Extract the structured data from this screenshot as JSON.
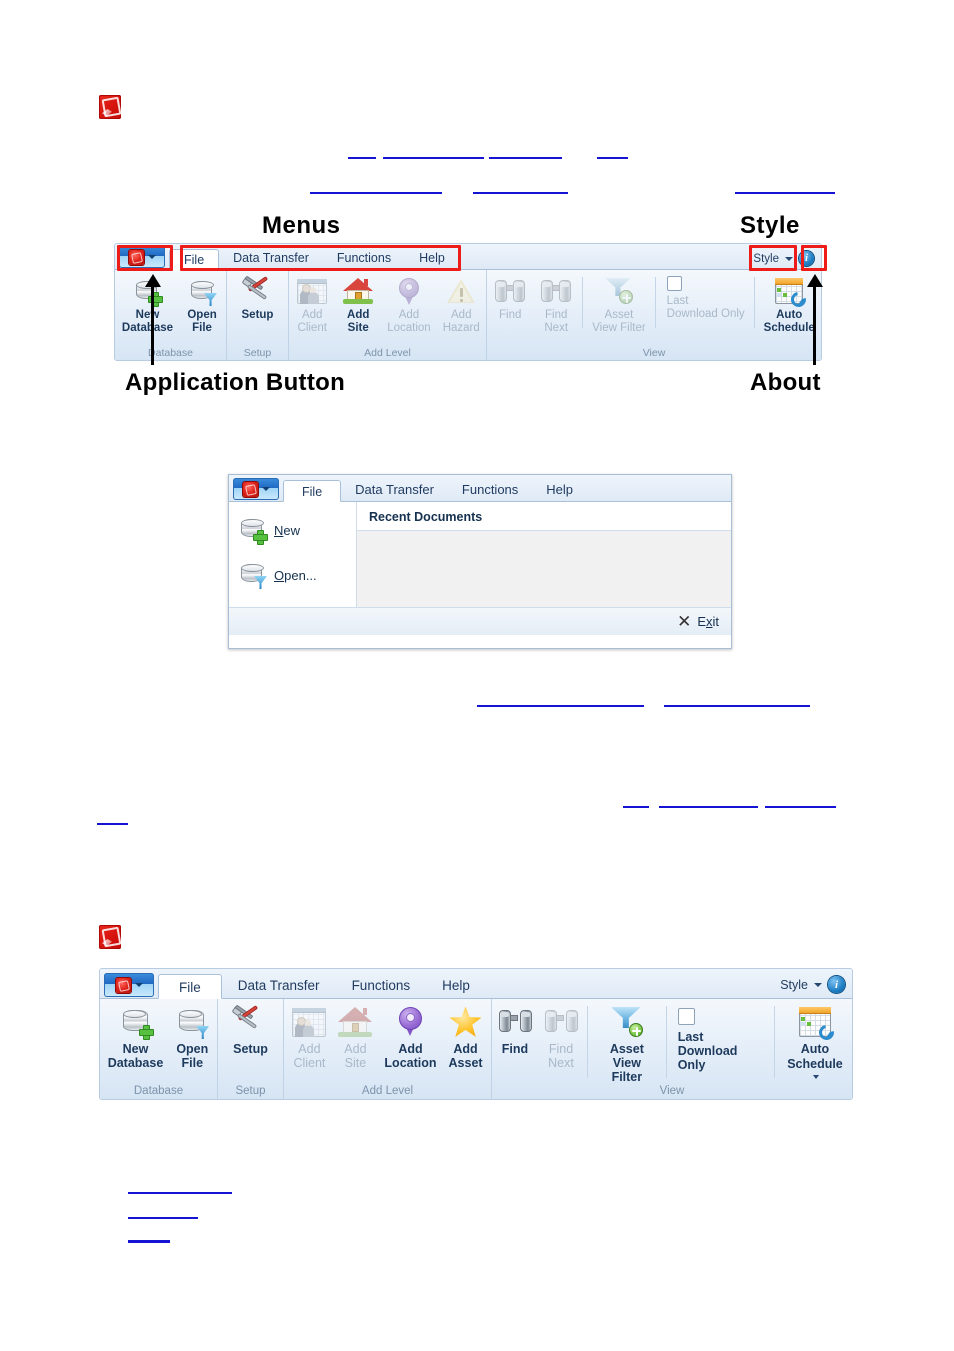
{
  "page": {
    "note_icons": [
      "note-icon-top",
      "note-icon-lower"
    ],
    "link_placeholders_count": 16
  },
  "annotations": {
    "menus_label": "Menus",
    "style_label": "Style",
    "application_button_label": "Application Button",
    "about_label": "About"
  },
  "ribbon_top": {
    "app_button": {
      "name": "Application Button",
      "caret": "▼"
    },
    "tabs": [
      {
        "label": "File",
        "active": true
      },
      {
        "label": "Data Transfer",
        "active": false
      },
      {
        "label": "Functions",
        "active": false
      },
      {
        "label": "Help",
        "active": false
      }
    ],
    "style_button": "Style",
    "about_icon": "i",
    "groups": [
      {
        "title": "Database",
        "buttons": [
          {
            "label": "New\nDatabase",
            "icon": "database-add-icon",
            "disabled": false
          },
          {
            "label": "Open\nFile",
            "icon": "database-open-icon",
            "disabled": false
          }
        ]
      },
      {
        "title": "Setup",
        "buttons": [
          {
            "label": "Setup",
            "icon": "tools-icon",
            "disabled": false
          }
        ]
      },
      {
        "title": "Add Level",
        "buttons": [
          {
            "label": "Add\nClient",
            "icon": "client-card-icon",
            "disabled": true
          },
          {
            "label": "Add\nSite",
            "icon": "house-icon",
            "disabled": false
          },
          {
            "label": "Add\nLocation",
            "icon": "map-pin-icon",
            "disabled": true
          },
          {
            "label": "Add\nHazard",
            "icon": "warning-triangle-icon",
            "disabled": true
          }
        ]
      },
      {
        "title": "View",
        "buttons": [
          {
            "label": "Find",
            "icon": "binoculars-icon",
            "disabled": true
          },
          {
            "label": "Find\nNext",
            "icon": "binoculars-icon",
            "disabled": true
          },
          {
            "label": "Asset\nView Filter",
            "icon": "funnel-add-icon",
            "disabled": true
          },
          {
            "label": "Last\nDownload Only",
            "icon": "checkbox-icon",
            "disabled": true,
            "type": "checkbox"
          },
          {
            "label": "Auto\nSchedule",
            "icon": "calendar-sync-icon",
            "disabled": false,
            "dropdown": true
          }
        ]
      }
    ]
  },
  "file_menu": {
    "app_button": {
      "name": "Application Button",
      "caret": "▼"
    },
    "tabs": [
      {
        "label": "File",
        "active": true
      },
      {
        "label": "Data Transfer",
        "active": false
      },
      {
        "label": "Functions",
        "active": false
      },
      {
        "label": "Help",
        "active": false
      }
    ],
    "items": [
      {
        "label": "New",
        "accel": "N",
        "icon": "database-add-icon"
      },
      {
        "label": "Open...",
        "accel": "O",
        "icon": "database-open-icon"
      }
    ],
    "recent_title": "Recent Documents",
    "recent_entries": [],
    "exit_label": "Exit",
    "exit_accel": "x",
    "exit_icon": "close-x-icon"
  },
  "ribbon_bottom": {
    "app_button": {
      "name": "Application Button",
      "caret": "▼"
    },
    "tabs": [
      {
        "label": "File",
        "active": true
      },
      {
        "label": "Data Transfer",
        "active": false
      },
      {
        "label": "Functions",
        "active": false
      },
      {
        "label": "Help",
        "active": false
      }
    ],
    "style_button": "Style",
    "about_icon": "i",
    "groups": [
      {
        "title": "Database",
        "buttons": [
          {
            "label": "New\nDatabase",
            "icon": "database-add-icon",
            "disabled": false
          },
          {
            "label": "Open\nFile",
            "icon": "database-open-icon",
            "disabled": false
          }
        ]
      },
      {
        "title": "Setup",
        "buttons": [
          {
            "label": "Setup",
            "icon": "tools-icon",
            "disabled": false
          }
        ]
      },
      {
        "title": "Add Level",
        "buttons": [
          {
            "label": "Add\nClient",
            "icon": "client-card-icon",
            "disabled": true
          },
          {
            "label": "Add\nSite",
            "icon": "house-icon",
            "disabled": true
          },
          {
            "label": "Add\nLocation",
            "icon": "map-pin-icon",
            "disabled": false
          },
          {
            "label": "Add\nAsset",
            "icon": "star-icon",
            "disabled": false
          }
        ]
      },
      {
        "title": "View",
        "buttons": [
          {
            "label": "Find",
            "icon": "binoculars-icon",
            "disabled": false
          },
          {
            "label": "Find\nNext",
            "icon": "binoculars-icon",
            "disabled": true
          },
          {
            "label": "Asset\nView Filter",
            "icon": "funnel-add-icon",
            "disabled": false
          },
          {
            "label": "Last\nDownload Only",
            "icon": "checkbox-icon",
            "disabled": false,
            "type": "checkbox"
          },
          {
            "label": "Auto\nSchedule",
            "icon": "calendar-sync-icon",
            "disabled": false,
            "dropdown": true
          }
        ]
      }
    ]
  },
  "colors": {
    "link_blue": "#1414d2",
    "annotation_red": "#ee1c18",
    "note_red": "#d6130d",
    "ribbon_blue": "#dfeaf6"
  }
}
